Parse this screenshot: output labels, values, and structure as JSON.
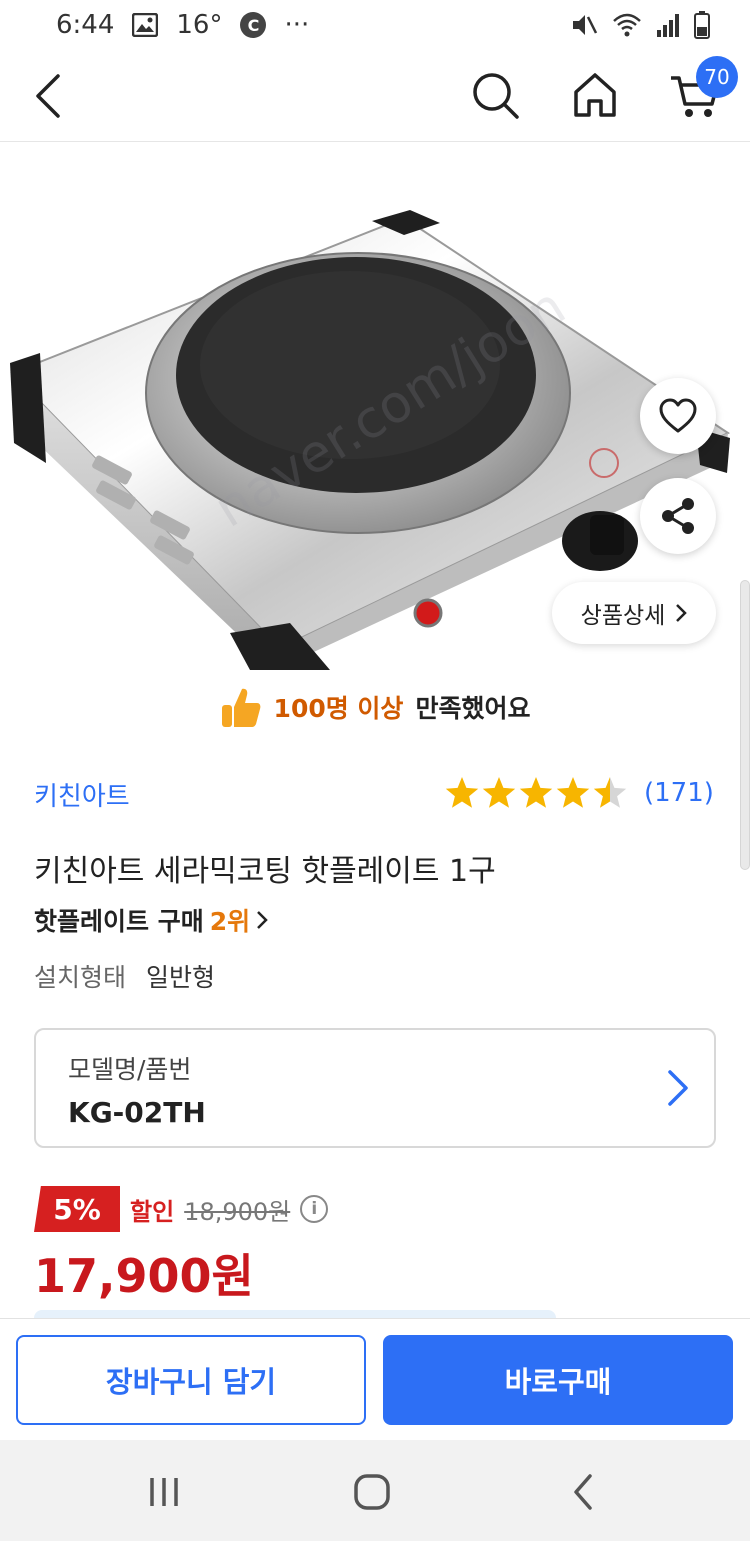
{
  "status_bar": {
    "time": "6:44",
    "temperature": "16°",
    "carrier_badge": "C",
    "more": "···"
  },
  "nav": {
    "cart_count": "70"
  },
  "image": {
    "watermark": "naver.com/joon"
  },
  "detail_button": {
    "label": "상품상세"
  },
  "satisfaction": {
    "highlight": "100명 이상",
    "rest": "만족했어요"
  },
  "product": {
    "brand": "키친아트",
    "rating_value": 4.5,
    "review_count": "(171)",
    "title": "키친아트 세라믹코팅 핫플레이트 1구",
    "rank_prefix": "핫플레이트 구매",
    "rank_value": "2위",
    "spec_key": "설치형태",
    "spec_value": "일반형"
  },
  "model": {
    "label": "모델명/품번",
    "value": "KG-02TH"
  },
  "price": {
    "discount_rate": "5%",
    "discount_label": "할인",
    "original": "18,900원",
    "final": "17,900원"
  },
  "actions": {
    "cart_label": "장바구니 담기",
    "buy_label": "바로구매"
  },
  "colors": {
    "accent": "#2d6ff5",
    "discount": "#d62020",
    "price": "#c8181d",
    "star": "#f7b500"
  }
}
